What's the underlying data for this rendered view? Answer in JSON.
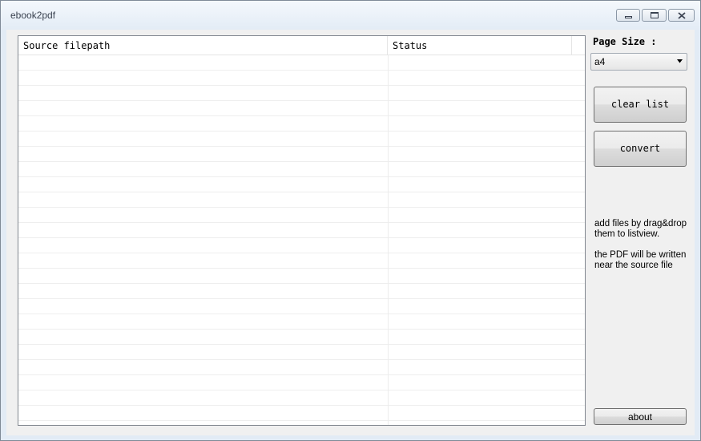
{
  "window": {
    "title": "ebook2pdf"
  },
  "listview": {
    "columns": [
      {
        "label": "Source filepath"
      },
      {
        "label": "Status"
      }
    ],
    "rows": []
  },
  "page_size": {
    "label": "Page Size :",
    "selected": "a4"
  },
  "buttons": {
    "clear_list": "clear list",
    "convert": "convert",
    "about": "about"
  },
  "help": {
    "line1": "add files by drag&drop them to listview.",
    "line2": "the PDF will be written near the source file"
  },
  "icons": {
    "minimize": "minimize-icon",
    "maximize": "maximize-icon",
    "close": "close-icon",
    "dropdown": "chevron-down-icon"
  }
}
